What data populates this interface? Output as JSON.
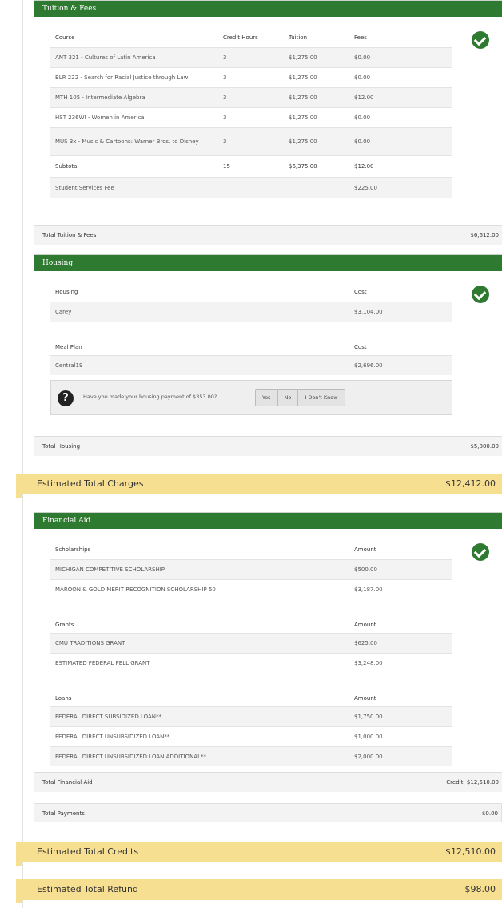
{
  "tuition": {
    "title": "Tuition & Fees",
    "headers": [
      "Course",
      "Credit Hours",
      "Tuition",
      "Fees"
    ],
    "rows": [
      [
        "ANT 321 - Cultures of Latin America",
        "3",
        "$1,275.00",
        "$0.00"
      ],
      [
        "BLR 222 - Search for Racial Justice through Law",
        "3",
        "$1,275.00",
        "$0.00"
      ],
      [
        "MTH 105 - Intermediate Algebra",
        "3",
        "$1,275.00",
        "$12.00"
      ],
      [
        "HST 236WI - Women in America",
        "3",
        "$1,275.00",
        "$0.00"
      ],
      [
        "MUS 3x - Music & Cartoons: Warner Bros. to Disney",
        "3",
        "$1,275.00",
        "$0.00"
      ]
    ],
    "subtotal": [
      "Subtotal",
      "15",
      "$6,375.00",
      "$12.00"
    ],
    "service_fee": [
      "Student Services Fee",
      "$225.00"
    ],
    "total_label": "Total Tuition & Fees",
    "total_value": "$6,612.00"
  },
  "housing": {
    "title": "Housing",
    "housing_header": [
      "Housing",
      "Cost"
    ],
    "housing_row": [
      "Carey",
      "$3,104.00"
    ],
    "meal_header": [
      "Meal Plan",
      "Cost"
    ],
    "meal_row": [
      "Central19",
      "$2,696.00"
    ],
    "question": "Have you made your housing payment of $353.00?",
    "buttons": [
      "Yes",
      "No",
      "I Don't Know"
    ],
    "total_label": "Total Housing",
    "total_value": "$5,800.00"
  },
  "est_charges": {
    "label": "Estimated Total Charges",
    "value": "$12,412.00"
  },
  "aid": {
    "title": "Financial Aid",
    "scholarships_header": [
      "Scholarships",
      "Amount"
    ],
    "scholarships": [
      [
        "MICHIGAN COMPETITIVE SCHOLARSHIP",
        "$500.00"
      ],
      [
        "MAROON & GOLD MERIT RECOGNITION SCHOLARSHIP 50",
        "$3,187.00"
      ]
    ],
    "grants_header": [
      "Grants",
      "Amount"
    ],
    "grants": [
      [
        "CMU TRADITIONS GRANT",
        "$625.00"
      ],
      [
        "ESTIMATED FEDERAL PELL GRANT",
        "$3,248.00"
      ]
    ],
    "loans_header": [
      "Loans",
      "Amount"
    ],
    "loans": [
      [
        "FEDERAL DIRECT SUBSIDIZED LOAN**",
        "$1,750.00"
      ],
      [
        "FEDERAL DIRECT UNSUBSIDIZED LOAN**",
        "$1,000.00"
      ],
      [
        "FEDERAL DIRECT UNSUBSIDIZED LOAN ADDITIONAL**",
        "$2,000.00"
      ]
    ],
    "total_label": "Total Financial Aid",
    "total_value": "Credit: $12,510.00"
  },
  "payments": {
    "label": "Total Payments",
    "value": "$0.00"
  },
  "est_credits": {
    "label": "Estimated Total Credits",
    "value": "$12,510.00"
  },
  "est_refund": {
    "label": "Estimated Total Refund",
    "value": "$98.00"
  }
}
